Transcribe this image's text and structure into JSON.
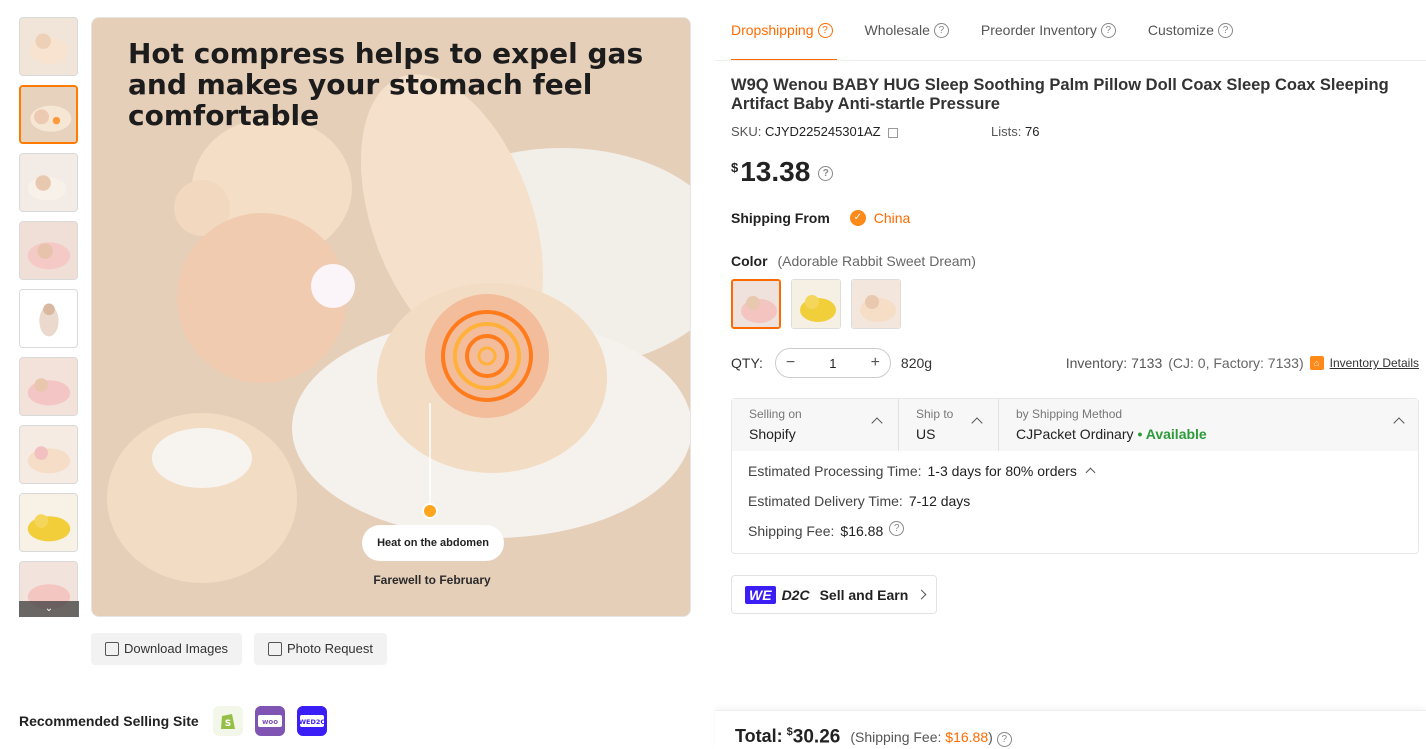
{
  "gallery": {
    "caption": "Hot compress helps to expel gas and makes your stomach feel comfortable",
    "heat_label": "Heat on the abdomen",
    "farewell": "Farewell to February",
    "download_label": "Download Images",
    "photo_request_label": "Photo Request"
  },
  "recommended": {
    "title": "Recommended Selling Site",
    "sites": [
      "shopify-icon",
      "woocommerce-icon",
      "wed2c-icon"
    ]
  },
  "tabs": [
    {
      "label": "Dropshipping",
      "active": true
    },
    {
      "label": "Wholesale"
    },
    {
      "label": "Preorder Inventory"
    },
    {
      "label": "Customize"
    }
  ],
  "product": {
    "title": "W9Q Wenou BABY HUG Sleep Soothing Palm Pillow Doll Coax Sleep Coax Sleeping Artifact Baby Anti-startle Pressure",
    "sku_label": "SKU:",
    "sku": "CJYD225245301AZ",
    "lists_label": "Lists:",
    "lists": "76",
    "currency": "$",
    "price": "13.38",
    "shipping_from_label": "Shipping From",
    "shipping_from": "China",
    "color_label": "Color",
    "color_selected": "(Adorable Rabbit Sweet Dream)",
    "qty_label": "QTY:",
    "qty": "1",
    "weight": "820g",
    "inventory": "Inventory: 7133",
    "inventory_detail": "(CJ: 0, Factory: 7133)",
    "inventory_link": "Inventory Details"
  },
  "shipping": {
    "selling_on_label": "Selling on",
    "selling_on": "Shopify",
    "ship_to_label": "Ship to",
    "ship_to": "US",
    "method_label": "by Shipping Method",
    "method": "CJPacket Ordinary",
    "available": "• Available",
    "processing_label": "Estimated Processing Time:",
    "processing": "1-3 days for 80% orders",
    "delivery_label": "Estimated Delivery Time:",
    "delivery": "7-12 days",
    "fee_label": "Shipping Fee:",
    "fee": "$16.88"
  },
  "d2c": {
    "we": "WE",
    "d2c": "D2C",
    "label": "Sell and Earn"
  },
  "total": {
    "label": "Total:",
    "currency": "$",
    "amount": "30.26",
    "fee_prefix": "(Shipping Fee:",
    "fee": "$16.88",
    "fee_suffix": ")"
  },
  "colors": {
    "accent": "#ff6a00",
    "available": "#2e9b3b"
  }
}
